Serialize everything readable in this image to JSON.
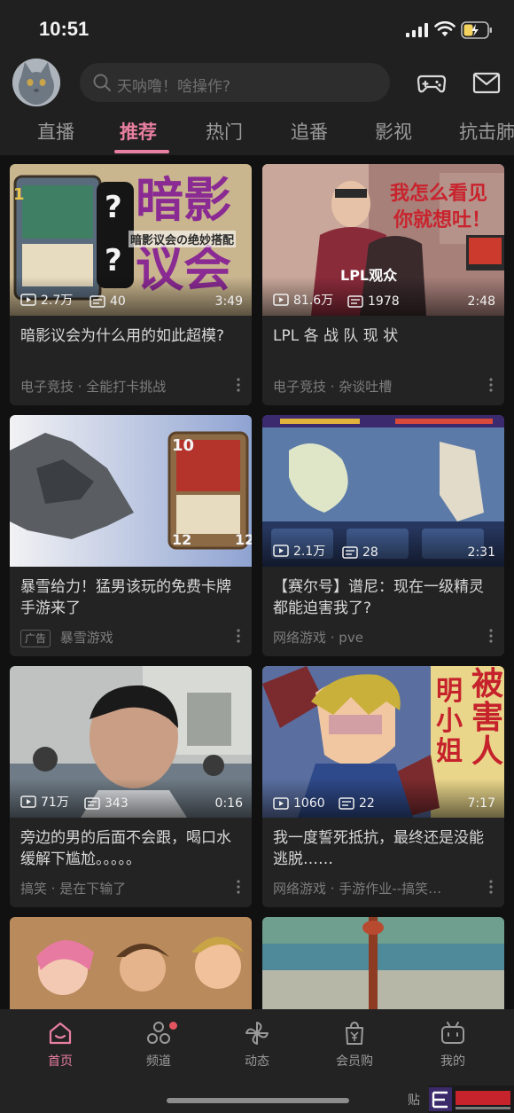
{
  "status_bar": {
    "time": "10:51"
  },
  "header": {
    "search_placeholder": "天呐噜！啥操作?"
  },
  "tabs": [
    {
      "label": "直播"
    },
    {
      "label": "推荐"
    },
    {
      "label": "热门"
    },
    {
      "label": "追番"
    },
    {
      "label": "影视"
    },
    {
      "label": "抗击肺"
    }
  ],
  "cards": [
    {
      "views": "2.7万",
      "danmaku": "40",
      "duration": "3:49",
      "title": "暗影议会为什么用的如此超模?",
      "channel": "电子竞技 · 全能打卡挑战",
      "thumb_text_1": "暗影",
      "thumb_text_2": "议会",
      "thumb_caption": "暗影议会の绝妙搭配"
    },
    {
      "views": "81.6万",
      "danmaku": "1978",
      "duration": "2:48",
      "title": "LPL 各 战 队 现 状",
      "channel": "电子竞技 · 杂谈吐槽",
      "thumb_text_1": "我怎么看见",
      "thumb_text_2": "你就想吐！",
      "thumb_caption": "LPL观众"
    },
    {
      "title": "暴雪给力！猛男该玩的免费卡牌手游来了",
      "ad_label": "广告",
      "channel": "暴雪游戏"
    },
    {
      "views": "2.1万",
      "danmaku": "28",
      "duration": "2:31",
      "title": "【赛尔号】谱尼：现在一级精灵都能迫害我了?",
      "channel": "网络游戏 · pve"
    },
    {
      "views": "71万",
      "danmaku": "343",
      "duration": "0:16",
      "title": "旁边的男的后面不会跟，喝口水缓解下尴尬。。。。。",
      "channel": "搞笑 · 是在下输了"
    },
    {
      "views": "1060",
      "danmaku": "22",
      "duration": "7:17",
      "title": "我一度誓死抵抗，最终还是没能逃脱……",
      "channel": "网络游戏 · 手游作业--搞笑…",
      "thumb_text_1": "被害人",
      "thumb_text_2": "明小姐"
    }
  ],
  "bottom_nav": [
    {
      "label": "首页"
    },
    {
      "label": "频道"
    },
    {
      "label": "动态"
    },
    {
      "label": "会员购"
    },
    {
      "label": "我的"
    }
  ],
  "watermark": {
    "paste": "贴"
  },
  "colors": {
    "accent": "#e87fa0",
    "background": "#111111",
    "card": "#232323"
  }
}
